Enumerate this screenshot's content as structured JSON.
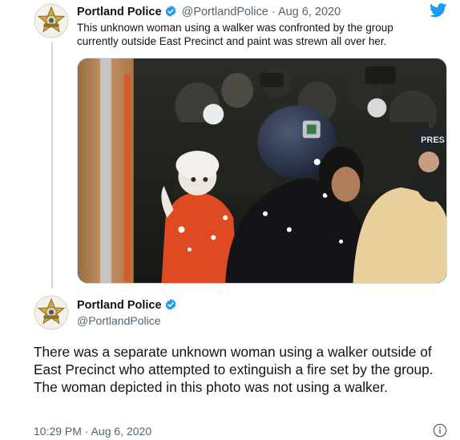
{
  "tweet1": {
    "name": "Portland Police",
    "handle": "@PortlandPolice",
    "separator": "·",
    "date": "Aug 6, 2020",
    "text": "This unknown woman using a walker was confronted by the group currently outside East Precinct and paint was strewn all over her.",
    "badge_text": "PORTLAND POLICE",
    "vest_text": "PRES"
  },
  "tweet2": {
    "name": "Portland Police",
    "handle": "@PortlandPolice",
    "text": "There was a separate unknown woman using a walker outside of East Precinct who attempted to extinguish a fire set by the group. The woman depicted in this photo was not using a walker.",
    "timestamp": "10:29 PM · Aug 6, 2020",
    "badge_text": "PORTLAND POLICE"
  },
  "icons": {
    "verified": "verified-badge-icon",
    "bird": "twitter-bird-icon",
    "info": "info-icon"
  },
  "colors": {
    "twitter_blue": "#1d9bf0",
    "text_primary": "#0f1419",
    "text_secondary": "#536471",
    "badge_gold": "#c9a648"
  }
}
